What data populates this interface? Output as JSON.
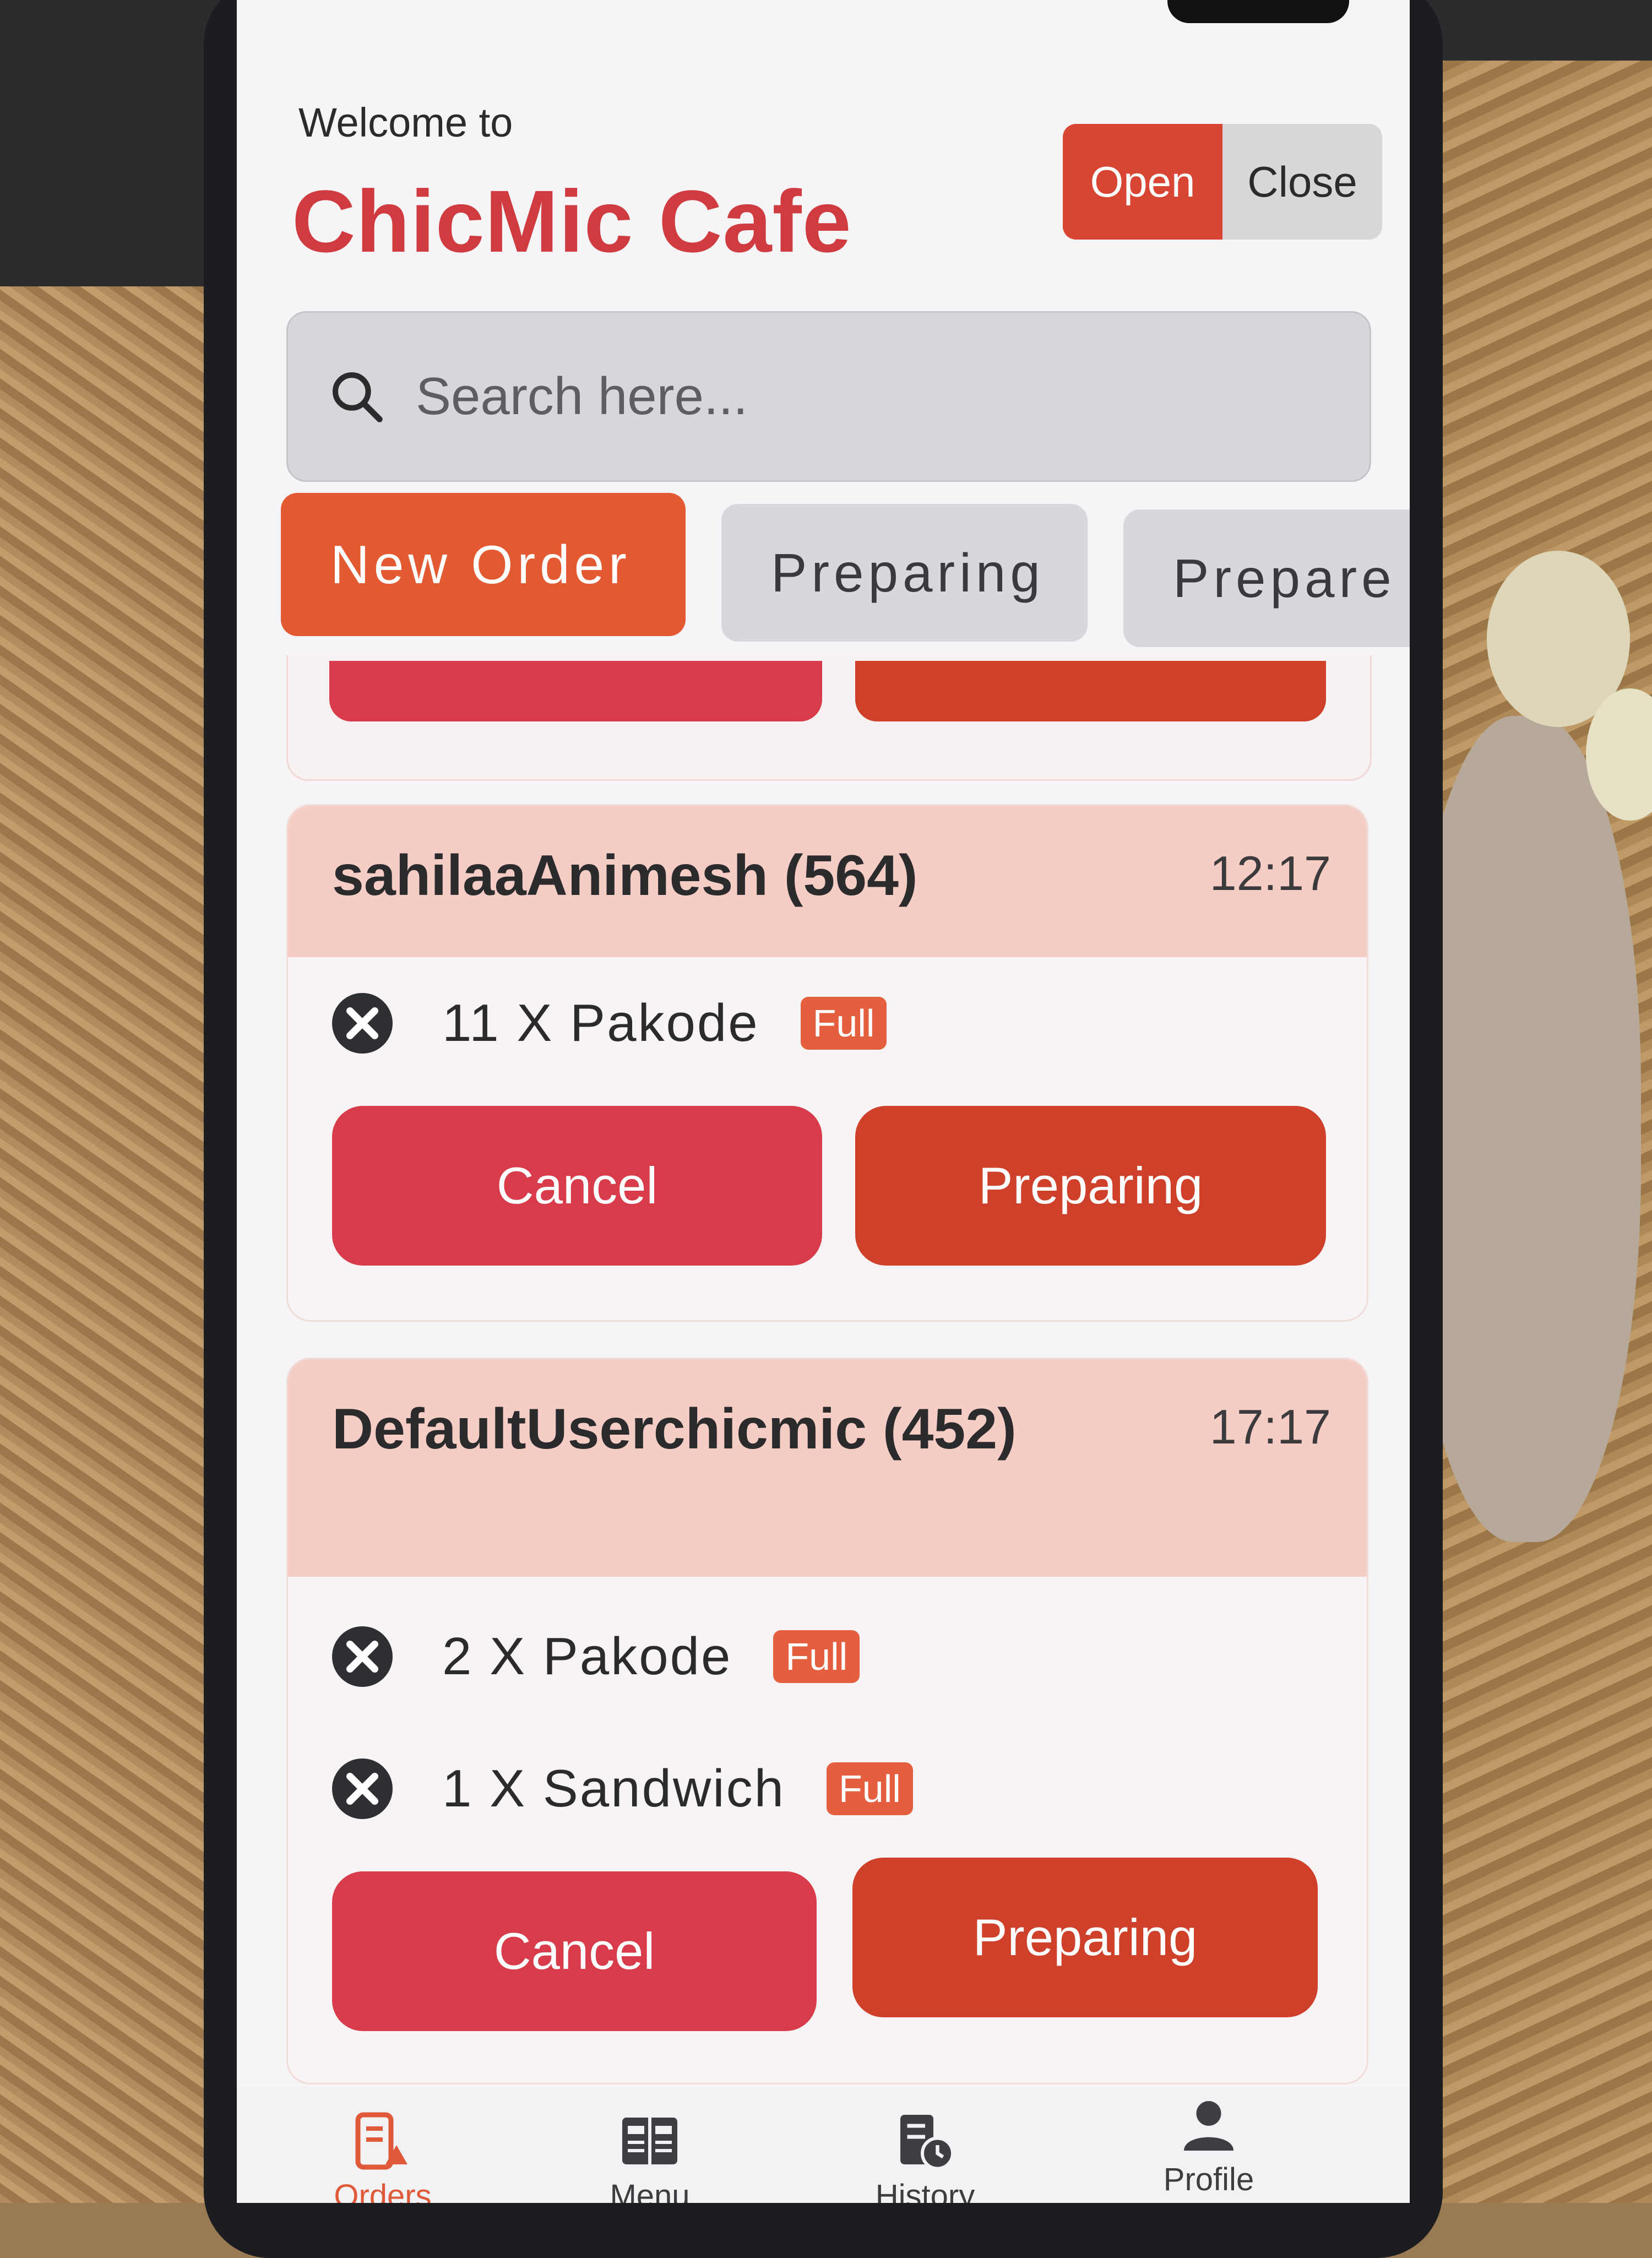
{
  "header": {
    "welcome": "Welcome to",
    "title": "ChicMic Cafe"
  },
  "store_status": {
    "open_label": "Open",
    "close_label": "Close",
    "selected": "Open"
  },
  "search": {
    "placeholder": "Search here...",
    "value": ""
  },
  "tabs": [
    {
      "label": "New Order",
      "active": true
    },
    {
      "label": "Preparing",
      "active": false
    },
    {
      "label": "Prepare",
      "active": false
    }
  ],
  "orders": [
    {
      "customer": "sahilaaAnimesh (564)",
      "time": "12:17",
      "items": [
        {
          "text": "11 X Pakode",
          "badge": "Full"
        }
      ],
      "cancel_label": "Cancel",
      "preparing_label": "Preparing"
    },
    {
      "customer": "DefaultUserchicmic (452)",
      "time": "17:17",
      "items": [
        {
          "text": "2 X Pakode",
          "badge": "Full"
        },
        {
          "text": "1 X Sandwich",
          "badge": "Full"
        }
      ],
      "cancel_label": "Cancel",
      "preparing_label": "Preparing"
    }
  ],
  "bottom_nav": [
    {
      "label": "Orders",
      "icon": "orders-icon",
      "active": true
    },
    {
      "label": "Menu",
      "icon": "menu-book-icon",
      "active": false
    },
    {
      "label": "History",
      "icon": "history-icon",
      "active": false
    },
    {
      "label": "Profile",
      "icon": "profile-icon",
      "active": false
    }
  ],
  "colors": {
    "accent": "#cf3b3e",
    "tab_active": "#e35a32",
    "cancel": "#d83b49",
    "preparing": "#cf402b",
    "card_header": "#f5cdc5"
  }
}
